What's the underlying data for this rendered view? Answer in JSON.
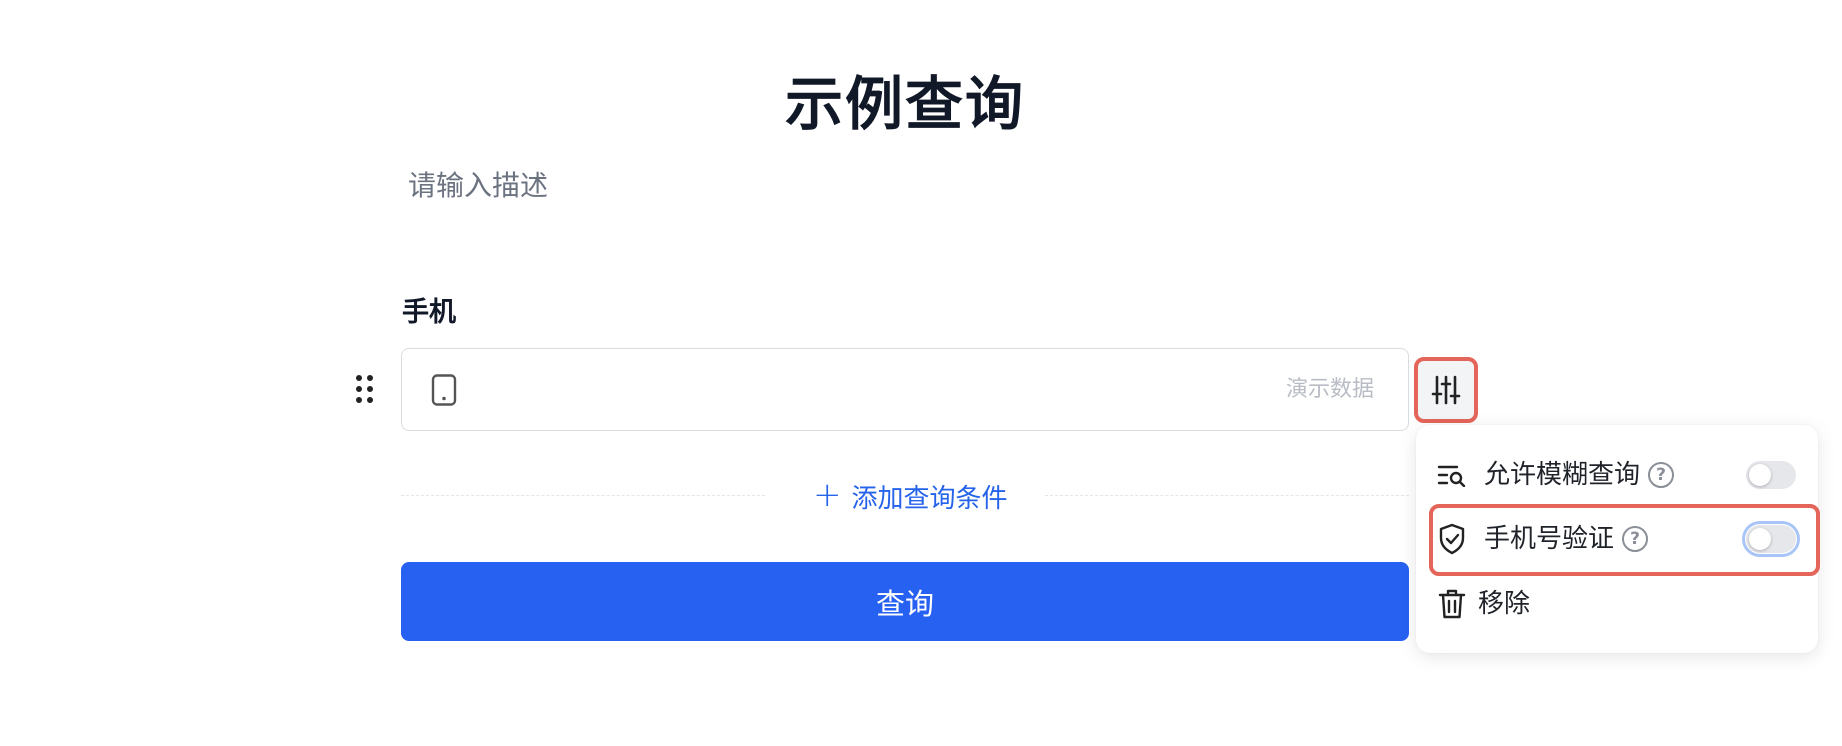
{
  "form": {
    "title": "示例查询",
    "description_placeholder": "请输入描述",
    "field_label": "手机",
    "input_value": "",
    "input_hint": "演示数据",
    "add_condition_label": "添加查询条件",
    "add_condition_icon": "plus-icon",
    "query_button_label": "查询"
  },
  "field_settings_menu": {
    "trigger_icon": "sliders-icon",
    "items": [
      {
        "label": "允许模糊查询",
        "icon": "fuzzy-search-icon",
        "has_help": true,
        "toggle_on": false
      },
      {
        "label": "手机号验证",
        "icon": "shield-check-icon",
        "has_help": true,
        "toggle_on": false
      },
      {
        "label": "移除",
        "icon": "trash-icon"
      }
    ],
    "help_glyph": "?"
  },
  "colors": {
    "accent": "#2761f1",
    "link": "#2563eb",
    "highlight": "#e4655a"
  }
}
